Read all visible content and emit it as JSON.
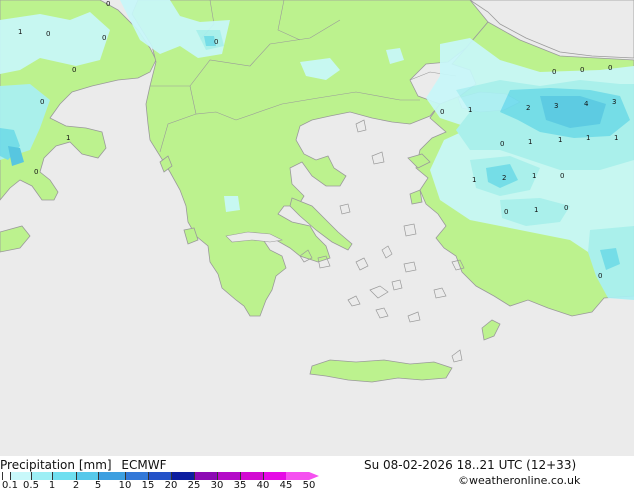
{
  "footer": {
    "title": "Precipitation [mm]",
    "model": "ECMWF",
    "valid_time": "Su 08-02-2026 18..21 UTC (12+33)",
    "credit": "©weatheronline.co.uk"
  },
  "legend": {
    "levels": [
      "0.1",
      "0.5",
      "1",
      "2",
      "5",
      "10",
      "15",
      "20",
      "25",
      "30",
      "35",
      "40",
      "45",
      "50"
    ],
    "colors": [
      "#ffffff",
      "#c8f8fa",
      "#9deff5",
      "#6fdff0",
      "#56c8ea",
      "#3c9fe0",
      "#3278d8",
      "#2452c8",
      "#0c1ea0",
      "#8c0ab4",
      "#b40ac8",
      "#d20ad2",
      "#e60ae6",
      "#f550f0"
    ]
  },
  "palette": {
    "sea": "#ebebeb",
    "land": "#bcf28e",
    "border": "#9a9a9a",
    "light_precip": "#a9f0f3",
    "moderate_precip": "#6fdcef",
    "heavy_precip": "#4fc3e8"
  },
  "map_values": [
    "0",
    "1",
    "0",
    "0",
    "0",
    "0",
    "1",
    "0",
    "0",
    "0",
    "0",
    "0",
    "0",
    "1",
    "2",
    "3",
    "4",
    "3",
    "0",
    "1",
    "1",
    "1",
    "1",
    "1",
    "2",
    "1",
    "0",
    "0",
    "1",
    "0",
    "0"
  ]
}
